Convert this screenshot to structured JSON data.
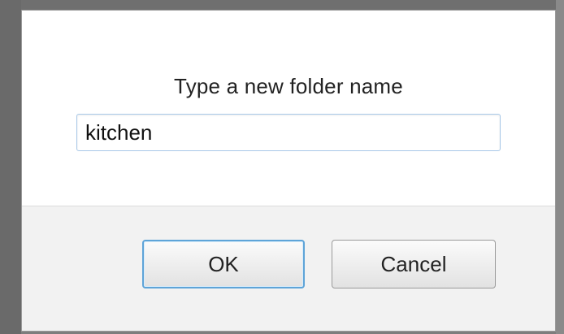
{
  "dialog": {
    "prompt": "Type a new folder name",
    "folder_name_value": "kitchen",
    "ok_label": "OK",
    "cancel_label": "Cancel"
  },
  "colors": {
    "focus_border": "#5ea4d8",
    "input_border": "#a8c8e8",
    "footer_background": "#f2f2f2"
  }
}
